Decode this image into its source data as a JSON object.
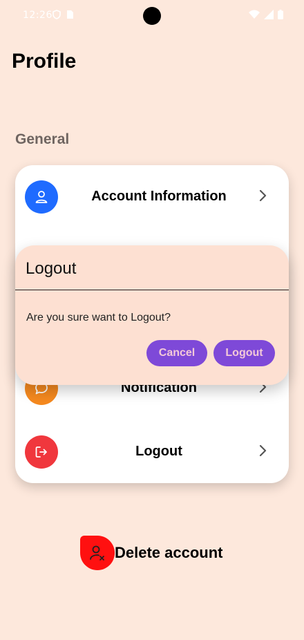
{
  "status_bar": {
    "time": "12:26"
  },
  "header": {
    "title": "Profile"
  },
  "section": {
    "label": "General"
  },
  "menu": {
    "items": [
      {
        "label": "Account Information",
        "icon": "user-icon",
        "color": "#1f6bff"
      },
      {
        "label": "Notification",
        "icon": "chat-bubble-icon",
        "color": "#f5891f"
      },
      {
        "label": "Logout",
        "icon": "logout-icon",
        "color": "#f0373d"
      }
    ]
  },
  "delete_account": {
    "label": "Delete account",
    "icon": "user-remove-icon",
    "color": "#ff1010"
  },
  "dialog": {
    "title": "Logout",
    "message": "Are you sure want to Logout?",
    "cancel_label": "Cancel",
    "confirm_label": "Logout",
    "button_color": "#7e49d8"
  }
}
